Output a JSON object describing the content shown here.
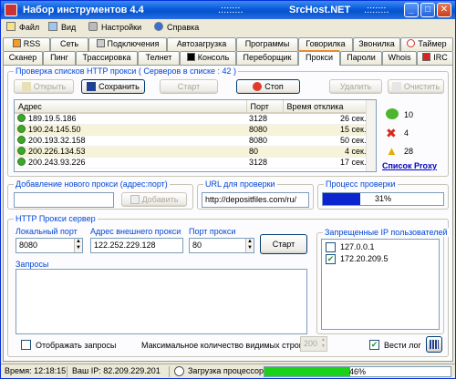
{
  "window": {
    "title_left": "Набор инструментов 4.4",
    "title_mid": ".:::::::.",
    "title_center": "SrcHost.NET",
    "title_right": ".:::::::."
  },
  "menu": [
    "Файл",
    "Вид",
    "Настройки",
    "Справка"
  ],
  "tabs_row1": [
    "RSS",
    "Сеть",
    "Подключения",
    "Автозагрузка",
    "Программы",
    "Говорилка",
    "Звонилка",
    "Таймер"
  ],
  "tabs_row2": [
    "Сканер",
    "Пинг",
    "Трассировка",
    "Телнет",
    "Консоль",
    "Переборщик",
    "Прокси",
    "Пароли",
    "Whois",
    "IRC"
  ],
  "active_tab": "Прокси",
  "check_group": {
    "title": "Проверка списков HTTP прокси ( Серверов в списке : 42 )",
    "btn_open": "Открыть",
    "btn_save": "Сохранить",
    "btn_start": "Старт",
    "btn_stop": "Стоп",
    "btn_delete": "Удалить",
    "btn_clear": "Очистить",
    "columns": [
      "Адрес",
      "Порт",
      "Время отклика"
    ],
    "rows": [
      {
        "addr": "189.19.5.186",
        "port": "3128",
        "time": "26 сек."
      },
      {
        "addr": "190.24.145.50",
        "port": "8080",
        "time": "15 сек."
      },
      {
        "addr": "200.193.32.158",
        "port": "8080",
        "time": "50 сек."
      },
      {
        "addr": "200.226.134.53",
        "port": "80",
        "time": "4 сек."
      },
      {
        "addr": "200.243.93.226",
        "port": "3128",
        "time": "17 сек."
      }
    ],
    "stats": {
      "ok": "10",
      "fail": "4",
      "warn": "28"
    },
    "proxy_list_link": "Список Proxy"
  },
  "add_proxy": {
    "title": "Добавление нового прокси (адрес:порт)",
    "value": "",
    "btn": "Добавить"
  },
  "check_url": {
    "title": "URL для проверки",
    "value": "http://depositfiles.com/ru/"
  },
  "progress": {
    "title": "Процесс проверки",
    "percent": 31,
    "label": "31%"
  },
  "server": {
    "title": "HTTP Прокси сервер",
    "local_port_label": "Локальный порт",
    "local_port": "8080",
    "ext_addr_label": "Адрес внешнего прокси",
    "ext_addr": "122.252.229.128",
    "proxy_port_label": "Порт прокси",
    "proxy_port": "80",
    "btn_start": "Старт",
    "requests_label": "Запросы",
    "banned_title": "Запрещенные IP пользователей",
    "banned": [
      {
        "ip": "127.0.0.1",
        "checked": false
      },
      {
        "ip": "172.20.209.5",
        "checked": true
      }
    ],
    "show_requests": "Отображать запросы",
    "max_rows_label": "Максимальное количество видимых строк",
    "max_rows": "200",
    "log_label": "Вести лог"
  },
  "status": {
    "time": "Время: 12:18:15",
    "ip": "Ваш IP: 82.209.229.201",
    "cpu_label": "Загрузка процессора:",
    "cpu_percent": 46,
    "cpu_text": "46%"
  }
}
